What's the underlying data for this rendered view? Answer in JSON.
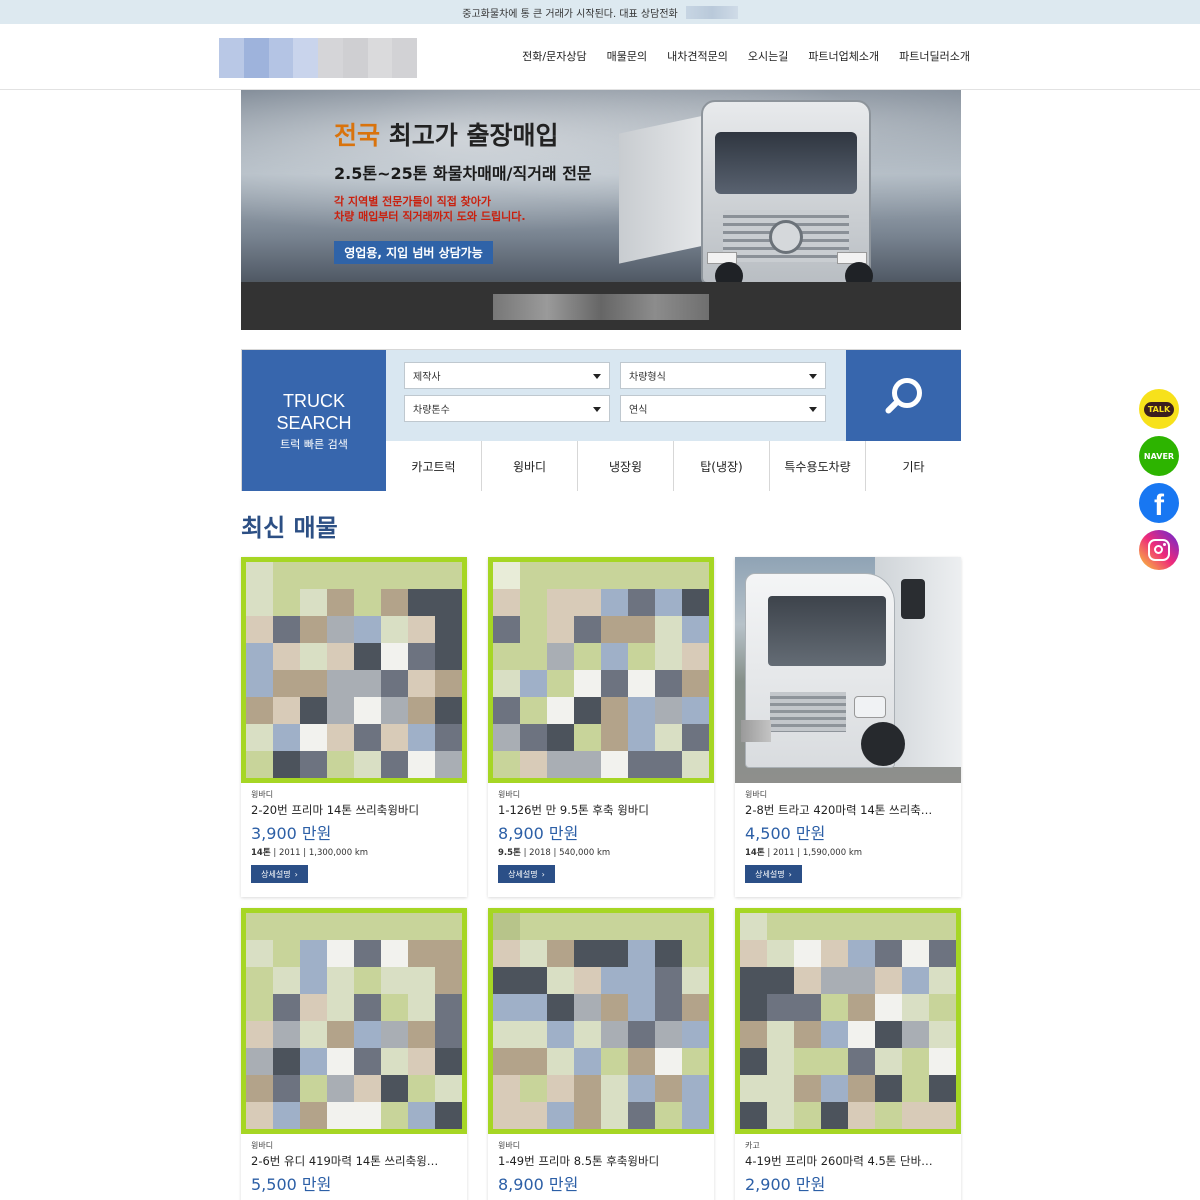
{
  "topbar": {
    "notice": "중고화물차에 통 큰 거래가 시작된다. 대표 상담전화"
  },
  "nav": {
    "items": [
      "전화/문자상담",
      "매물문의",
      "내차견적문의",
      "오시는길",
      "파트너업체소개",
      "파트너딜러소개"
    ]
  },
  "banner": {
    "title_highlight": "전국",
    "title_rest": "최고가 출장매입",
    "subtitle": "2.5톤~25톤 화물차매매/직거래 전문",
    "desc_line1": "각 지역별 전문가들이 직접 찾아가",
    "desc_line2": "차량 매입부터 직거래까지 도와 드립니다.",
    "button": "영업용, 지입 넘버 상담가능"
  },
  "search": {
    "title_line1": "TRUCK",
    "title_line2": "SEARCH",
    "title_sub": "트럭 빠른 검색",
    "selects": [
      "제작사",
      "차량형식",
      "차량톤수",
      "연식"
    ],
    "categories": [
      "카고트럭",
      "윙바디",
      "냉장윙",
      "탑(냉장)",
      "특수용도차량",
      "기타"
    ]
  },
  "section": {
    "title": "최신 매물"
  },
  "listings": [
    {
      "category": "윙바디",
      "name": "2-20번 프리마 14톤 쓰리축윙바디",
      "price": "3,900 만원",
      "ton": "14톤",
      "year": "2011",
      "km": "1,300,000 km",
      "button": "상세설명"
    },
    {
      "category": "윙바디",
      "name": "1-126번 만 9.5톤 후축 윙바디",
      "price": "8,900 만원",
      "ton": "9.5톤",
      "year": "2018",
      "km": "540,000 km",
      "button": "상세설명"
    },
    {
      "category": "윙바디",
      "name": "2-8번 트라고 420마력 14톤 쓰리축…",
      "price": "4,500 만원",
      "ton": "14톤",
      "year": "2011",
      "km": "1,590,000 km",
      "button": "상세설명"
    },
    {
      "category": "윙바디",
      "name": "2-6번 유디 419마력 14톤 쓰리축윙…",
      "price": "5,500 만원"
    },
    {
      "category": "윙바디",
      "name": "1-49번 프리마 8.5톤 후축윙바디",
      "price": "8,900 만원"
    },
    {
      "category": "카고",
      "name": "4-19번 프리마 260마력 4.5톤 단바…",
      "price": "2,900 만원"
    }
  ],
  "social": {
    "kakao": "TALK",
    "naver": "NAVER",
    "facebook": "f"
  },
  "icons": [
    "search-icon",
    "chevron-down-icon",
    "chevron-right-icon",
    "kakao-talk-icon",
    "naver-icon",
    "facebook-icon",
    "instagram-icon"
  ],
  "colors": {
    "primary": "#3766ad",
    "price": "#2c5fa6",
    "frame": "#a6d624",
    "banner_highlight": "#d9730c",
    "banner_desc": "#c9210f"
  }
}
